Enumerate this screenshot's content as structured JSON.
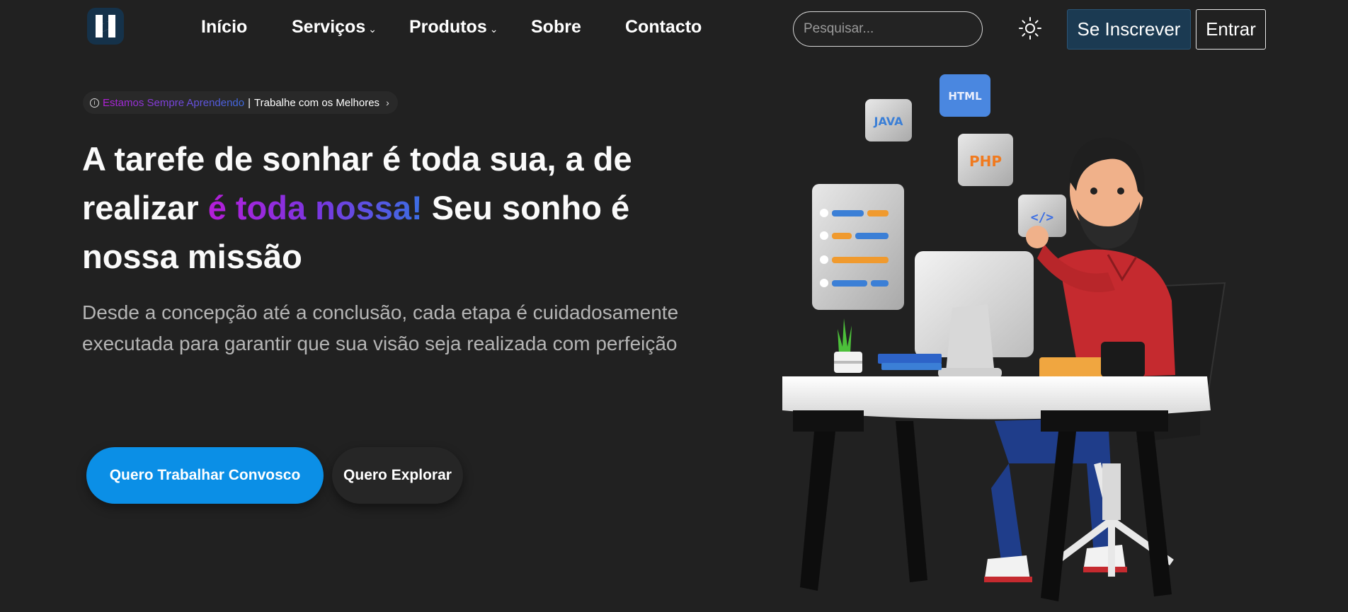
{
  "nav": {
    "logo_icon": "brand-logo-icon",
    "links": [
      {
        "label": "Início",
        "dropdown": false
      },
      {
        "label": "Serviços",
        "dropdown": true
      },
      {
        "label": "Produtos",
        "dropdown": true
      },
      {
        "label": "Sobre",
        "dropdown": false
      },
      {
        "label": "Contacto",
        "dropdown": false
      }
    ],
    "search_placeholder": "Pesquisar...",
    "theme_icon": "sun-icon",
    "signup_label": "Se Inscrever",
    "login_label": "Entrar"
  },
  "hero": {
    "pill": {
      "gradient_text": "Estamos Sempre Aprendendo",
      "separator": "|",
      "text": "Trabalhe com os Melhores"
    },
    "headline": {
      "part1": "A tarefe de sonhar é toda sua, a de realizar ",
      "highlight": "é toda nossa!",
      "part2": " Seu sonho é nossa missão"
    },
    "subtitle": "Desde a concepção até a conclusão, cada etapa é cuidadosamente executada para garantir que sua visão seja realizada com perfeição",
    "primary_button": "Quero Trabalhar Convosco",
    "secondary_button": "Quero Explorar"
  },
  "illustration": {
    "badges": [
      "JAVA",
      "HTML",
      "PHP",
      "</>"
    ]
  },
  "colors": {
    "background": "#212121",
    "primary": "#0b8fe6",
    "signup_bg": "#1b3a52",
    "gradient_start": "#b51ed9",
    "gradient_end": "#3b6ee3"
  }
}
